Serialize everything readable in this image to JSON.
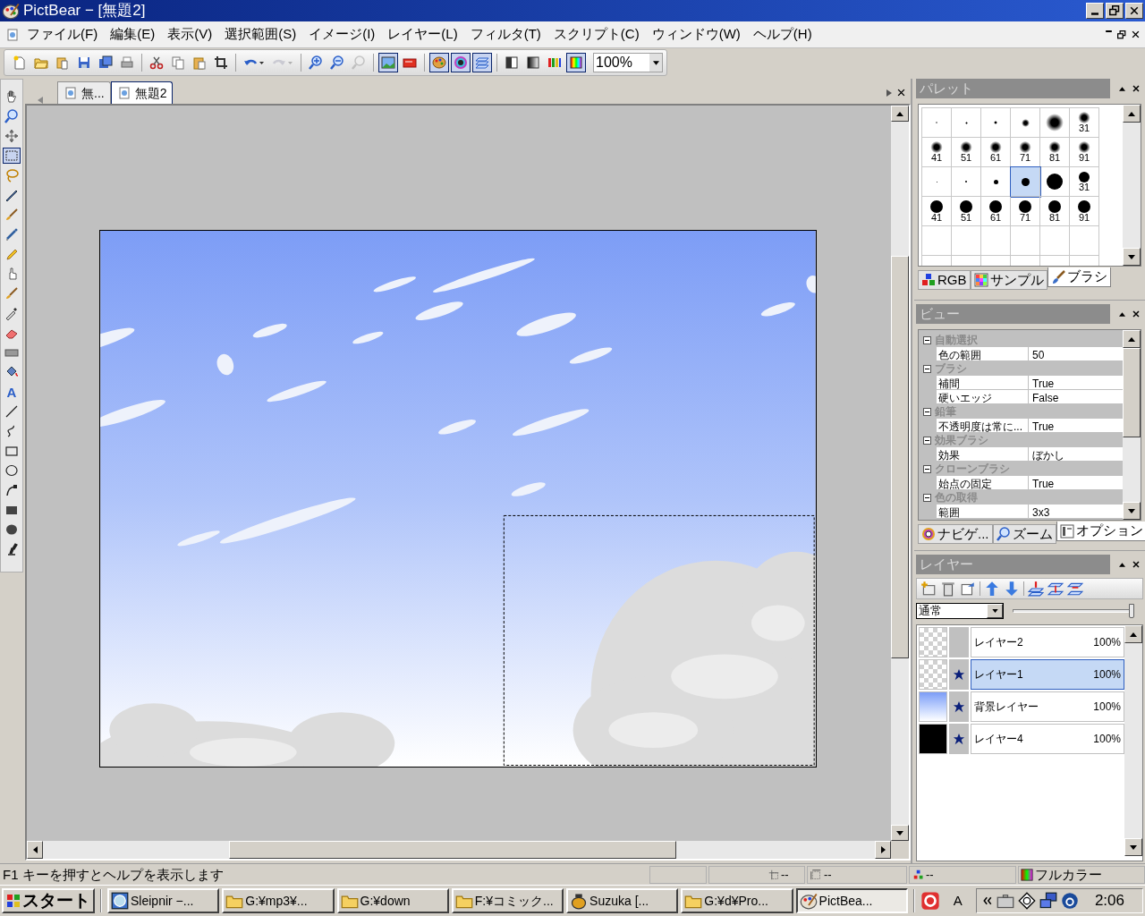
{
  "window": {
    "title": "PictBear − [無題2]"
  },
  "menu": [
    "ファイル(F)",
    "編集(E)",
    "表示(V)",
    "選択範囲(S)",
    "イメージ(I)",
    "レイヤー(L)",
    "フィルタ(T)",
    "スクリプト(C)",
    "ウィンドウ(W)",
    "ヘルプ(H)"
  ],
  "toolbar": [
    {
      "kind": "new",
      "pressed": false,
      "disabled": false
    },
    {
      "kind": "open",
      "pressed": false,
      "disabled": false
    },
    {
      "kind": "pastenew",
      "pressed": false,
      "disabled": false
    },
    {
      "kind": "save",
      "pressed": false,
      "disabled": false
    },
    {
      "kind": "saveall",
      "pressed": false,
      "disabled": false
    },
    {
      "kind": "print",
      "pressed": false,
      "disabled": false
    },
    {
      "kind": "separator"
    },
    {
      "kind": "cut",
      "pressed": false,
      "disabled": false
    },
    {
      "kind": "copy",
      "pressed": false,
      "disabled": false
    },
    {
      "kind": "paste",
      "pressed": false,
      "disabled": false
    },
    {
      "kind": "crop",
      "pressed": false,
      "disabled": false
    },
    {
      "kind": "separator"
    },
    {
      "kind": "undo",
      "pressed": false,
      "disabled": false
    },
    {
      "kind": "redo",
      "pressed": false,
      "disabled": true
    },
    {
      "kind": "separator"
    },
    {
      "kind": "zoomin",
      "pressed": false,
      "disabled": false
    },
    {
      "kind": "zoomout",
      "pressed": false,
      "disabled": false
    },
    {
      "kind": "zoomfit",
      "pressed": false,
      "disabled": true
    },
    {
      "kind": "separator"
    },
    {
      "kind": "picture",
      "pressed": true,
      "disabled": false
    },
    {
      "kind": "card",
      "pressed": false,
      "disabled": false
    },
    {
      "kind": "separator"
    },
    {
      "kind": "palette",
      "pressed": true,
      "disabled": false
    },
    {
      "kind": "wheel",
      "pressed": true,
      "disabled": false
    },
    {
      "kind": "layers",
      "pressed": true,
      "disabled": false
    },
    {
      "kind": "separator"
    },
    {
      "kind": "half",
      "pressed": false,
      "disabled": false
    },
    {
      "kind": "gradient",
      "pressed": false,
      "disabled": false
    },
    {
      "kind": "bars",
      "pressed": false,
      "disabled": false
    },
    {
      "kind": "spectrum",
      "pressed": true,
      "disabled": false
    }
  ],
  "zoom": {
    "value": "100%"
  },
  "tools": [
    {
      "kind": "hand",
      "selected": false
    },
    {
      "kind": "zoom",
      "selected": false
    },
    {
      "kind": "move",
      "selected": false
    },
    {
      "kind": "rectselect",
      "selected": true
    },
    {
      "kind": "lasso",
      "selected": false
    },
    {
      "kind": "pen",
      "selected": false
    },
    {
      "kind": "brush",
      "selected": false
    },
    {
      "kind": "airbrush",
      "selected": false
    },
    {
      "kind": "pencil",
      "selected": false
    },
    {
      "kind": "finger",
      "selected": false
    },
    {
      "kind": "brush",
      "selected": false
    },
    {
      "kind": "dropper",
      "selected": false
    },
    {
      "kind": "eraser",
      "selected": false
    },
    {
      "kind": "gradient",
      "selected": false
    },
    {
      "kind": "bucket",
      "selected": false
    },
    {
      "kind": "text",
      "label": "A",
      "selected": false
    },
    {
      "kind": "line",
      "selected": false
    },
    {
      "kind": "curve",
      "selected": false
    },
    {
      "kind": "rect",
      "selected": false
    },
    {
      "kind": "ellipse",
      "selected": false
    },
    {
      "kind": "bezier",
      "selected": false
    },
    {
      "kind": "fillrect",
      "selected": false
    },
    {
      "kind": "fillellipse",
      "selected": false
    },
    {
      "kind": "stamp",
      "selected": false
    }
  ],
  "doc_tabs": [
    {
      "label": "無...",
      "selected": false
    },
    {
      "label": "無題2",
      "selected": true
    }
  ],
  "palette": {
    "title": "パレット",
    "brushes": [
      {
        "kind": "soft",
        "selected": false
      },
      {
        "kind": "soft",
        "selected": false
      },
      {
        "kind": "soft",
        "selected": false
      },
      {
        "kind": "soft",
        "selected": false
      },
      {
        "kind": "soft",
        "selected": false
      },
      {
        "kind": "soft",
        "label": "31",
        "selected": false
      },
      {
        "kind": "soft",
        "label": "41",
        "selected": false
      },
      {
        "kind": "soft",
        "label": "51",
        "selected": false
      },
      {
        "kind": "soft",
        "label": "61",
        "selected": false
      },
      {
        "kind": "soft",
        "label": "71",
        "selected": false
      },
      {
        "kind": "soft",
        "label": "81",
        "selected": false
      },
      {
        "kind": "soft",
        "label": "91",
        "selected": false
      },
      {
        "kind": "hard",
        "selected": false
      },
      {
        "kind": "hard",
        "selected": false
      },
      {
        "kind": "hard",
        "selected": false
      },
      {
        "kind": "hard",
        "selected": true
      },
      {
        "kind": "hard",
        "selected": false
      },
      {
        "kind": "hard",
        "label": "31",
        "selected": false
      },
      {
        "kind": "hard",
        "label": "41",
        "selected": false
      },
      {
        "kind": "hard",
        "label": "51",
        "selected": false
      },
      {
        "kind": "hard",
        "label": "61",
        "selected": false
      },
      {
        "kind": "hard",
        "label": "71",
        "selected": false
      },
      {
        "kind": "hard",
        "label": "81",
        "selected": false
      },
      {
        "kind": "hard",
        "label": "91",
        "selected": false
      }
    ],
    "tabs": [
      {
        "kind": "rgb",
        "label": "RGB",
        "selected": false
      },
      {
        "kind": "sample",
        "label": "サンプル",
        "selected": false
      },
      {
        "kind": "brush",
        "label": "ブラシ",
        "selected": true
      }
    ]
  },
  "view": {
    "title": "ビュー",
    "groups": [
      {
        "name": "自動選択",
        "expanded": true,
        "properties": [
          {
            "name": "色の範囲",
            "value": "50"
          }
        ]
      },
      {
        "name": "ブラシ",
        "expanded": true,
        "properties": [
          {
            "name": "補間",
            "value": "True"
          },
          {
            "name": "硬いエッジ",
            "value": "False"
          }
        ]
      },
      {
        "name": "鉛筆",
        "expanded": true,
        "properties": [
          {
            "name": "不透明度は常に...",
            "value": "True"
          }
        ]
      },
      {
        "name": "効果ブラシ",
        "expanded": true,
        "properties": [
          {
            "name": "効果",
            "value": "ぼかし"
          }
        ]
      },
      {
        "name": "クローンブラシ",
        "expanded": true,
        "properties": [
          {
            "name": "始点の固定",
            "value": "True"
          }
        ]
      },
      {
        "name": "色の取得",
        "expanded": true,
        "properties": [
          {
            "name": "範囲",
            "value": "3x3"
          }
        ]
      }
    ],
    "tabs": [
      {
        "kind": "navigator",
        "label": "ナビゲ...",
        "selected": false
      },
      {
        "kind": "zoom",
        "label": "ズーム",
        "selected": false
      },
      {
        "kind": "options",
        "label": "オプション",
        "selected": true
      }
    ]
  },
  "layers": {
    "title": "レイヤー",
    "blend_mode": "通常",
    "opacity": {
      "level": 1
    },
    "items": [
      {
        "name": "レイヤー2",
        "opacity": "100%",
        "kind": "transparent",
        "marked": false,
        "selected": false
      },
      {
        "name": "レイヤー1",
        "opacity": "100%",
        "kind": "transparent",
        "marked": true,
        "selected": true
      },
      {
        "name": "背景レイヤー",
        "opacity": "100%",
        "kind": "gradient",
        "marked": true,
        "selected": false
      },
      {
        "name": "レイヤー4",
        "opacity": "100%",
        "kind": "black",
        "marked": true,
        "selected": false
      }
    ]
  },
  "status_bar": {
    "help": "F1 キーを押すとヘルプを表示します",
    "cursor": "--",
    "size": "--",
    "color_info": "--",
    "mode": "フルカラー"
  },
  "taskbar": {
    "start": "スタート",
    "buttons": [
      {
        "kind": "browser",
        "label": "Sleipnir −...",
        "selected": false
      },
      {
        "kind": "folder",
        "label": "G:¥mp3¥...",
        "selected": false
      },
      {
        "kind": "folder",
        "label": "G:¥down",
        "selected": false
      },
      {
        "kind": "folder",
        "label": "F:¥コミック...",
        "selected": false
      },
      {
        "kind": "app",
        "label": "Suzuka [...",
        "selected": false
      },
      {
        "kind": "folder",
        "label": "G:¥d¥Pro...",
        "selected": false
      },
      {
        "kind": "paint",
        "label": "PictBea...",
        "selected": true
      }
    ],
    "ime": "A",
    "clock": "2:06"
  }
}
